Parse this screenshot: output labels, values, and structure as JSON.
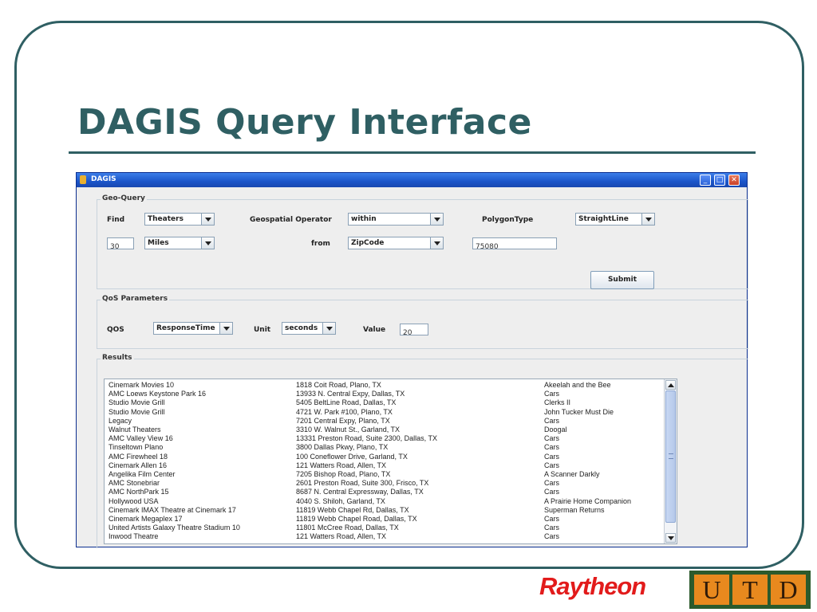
{
  "slide": {
    "title": "DAGIS Query Interface"
  },
  "window": {
    "title": "DAGIS",
    "min_icon": "minimize-icon",
    "max_icon": "maximize-icon",
    "close_icon": "close-icon"
  },
  "geo_query": {
    "group_label": "Geo-Query",
    "find_label": "Find",
    "find_value": "Theaters",
    "distance_value": "30",
    "unit_value": "Miles",
    "operator_label": "Geospatial Operator",
    "operator_value": "within",
    "from_label": "from",
    "from_value": "ZipCode",
    "zip_value": "75080",
    "polygon_label": "PolygonType",
    "polygon_value": "StraightLine",
    "submit_label": "Submit"
  },
  "qos": {
    "group_label": "QoS Parameters",
    "qos_label": "QOS",
    "qos_value": "ResponseTime",
    "unit_label": "Unit",
    "unit_value": "seconds",
    "value_label": "Value",
    "value_value": "20"
  },
  "results": {
    "group_label": "Results",
    "rows": [
      [
        "Cinemark Movies 10",
        "1818 Coit Road, Plano, TX",
        "Akeelah and the Bee"
      ],
      [
        "AMC Loews Keystone Park 16",
        "13933 N. Central Expy, Dallas, TX",
        "Cars"
      ],
      [
        "Studio Movie Grill",
        "5405 BeltLine Road, Dallas, TX",
        "Clerks II"
      ],
      [
        "Studio Movie Grill",
        "4721 W. Park #100, Plano, TX",
        "John Tucker Must Die"
      ],
      [
        "Legacy",
        "7201 Central Expy, Plano, TX",
        "Cars"
      ],
      [
        "Walnut Theaters",
        "3310 W. Walnut St., Garland, TX",
        "Doogal"
      ],
      [
        "AMC Valley View 16",
        "13331 Preston Road, Suite 2300, Dallas, TX",
        "Cars"
      ],
      [
        "Tinseltown Plano",
        "3800 Dallas Pkwy, Plano, TX",
        "Cars"
      ],
      [
        "AMC Firewheel 18",
        "100 Coneflower Drive, Garland, TX",
        "Cars"
      ],
      [
        "Cinemark Allen 16",
        "121 Watters Road, Allen, TX",
        "Cars"
      ],
      [
        "Angelika Film Center",
        "7205 Bishop Road, Plano, TX",
        "A Scanner Darkly"
      ],
      [
        "AMC Stonebriar",
        "2601 Preston Road, Suite 300, Frisco, TX",
        "Cars"
      ],
      [
        "AMC NorthPark 15",
        "8687 N. Central Expressway, Dallas, TX",
        "Cars"
      ],
      [
        "Hollywood USA",
        "4040 S. Shiloh, Garland, TX",
        "A Prairie Home Companion"
      ],
      [
        "Cinemark IMAX Theatre at Cinemark 17",
        "11819 Webb Chapel Rd, Dallas, TX",
        "Superman Returns"
      ],
      [
        "Cinemark Megaplex 17",
        "11819 Webb Chapel Road, Dallas, TX",
        "Cars"
      ],
      [
        "United Artists Galaxy Theatre Stadium 10",
        "11801 McCree Road, Dallas, TX",
        "Cars"
      ],
      [
        "Inwood Theatre",
        "121 Watters Road, Allen, TX",
        "Cars"
      ]
    ]
  },
  "logos": {
    "raytheon": "Raytheon",
    "utd": [
      "U",
      "T",
      "D"
    ]
  }
}
